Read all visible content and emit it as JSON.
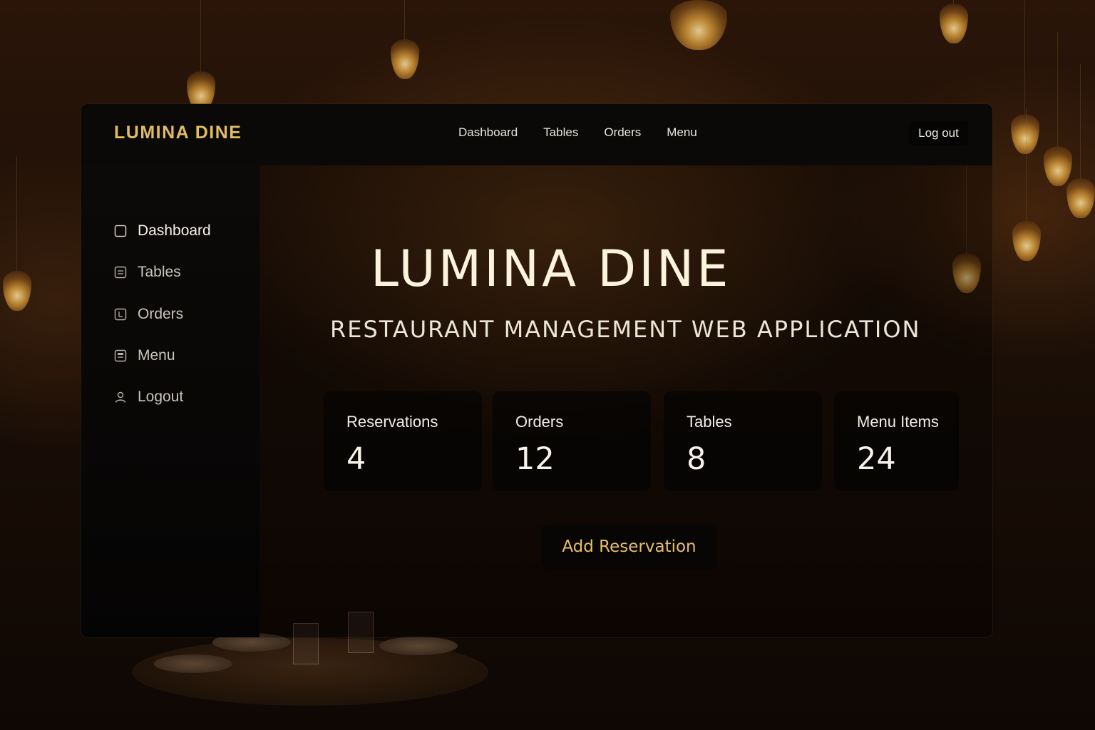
{
  "brand": {
    "name": "LUMINA DINE"
  },
  "colors": {
    "accent": "#e3bb63",
    "window": "#0a0908",
    "card": "#060504"
  },
  "topnav": {
    "items": [
      {
        "label": "Dashboard"
      },
      {
        "label": "Tables"
      },
      {
        "label": "Orders"
      },
      {
        "label": "Menu"
      }
    ],
    "logout_label": "Log out"
  },
  "sidebar": {
    "items": [
      {
        "label": "Dashboard",
        "icon": "square-icon",
        "active": true
      },
      {
        "label": "Tables",
        "icon": "list-icon",
        "active": false
      },
      {
        "label": "Orders",
        "icon": "receipt-icon",
        "active": false
      },
      {
        "label": "Menu",
        "icon": "book-icon",
        "active": false
      },
      {
        "label": "Logout",
        "icon": "user-icon",
        "active": false
      }
    ]
  },
  "hero": {
    "title": "LUMINA DINE",
    "subtitle": "RESTAURANT MANAGEMENT WEB APPLICATION"
  },
  "stats": [
    {
      "label": "Reservations",
      "value": "4"
    },
    {
      "label": "Orders",
      "value": "12"
    },
    {
      "label": "Tables",
      "value": "8"
    },
    {
      "label": "Menu Items",
      "value": "24"
    }
  ],
  "cta": {
    "label": "Add Reservation"
  }
}
